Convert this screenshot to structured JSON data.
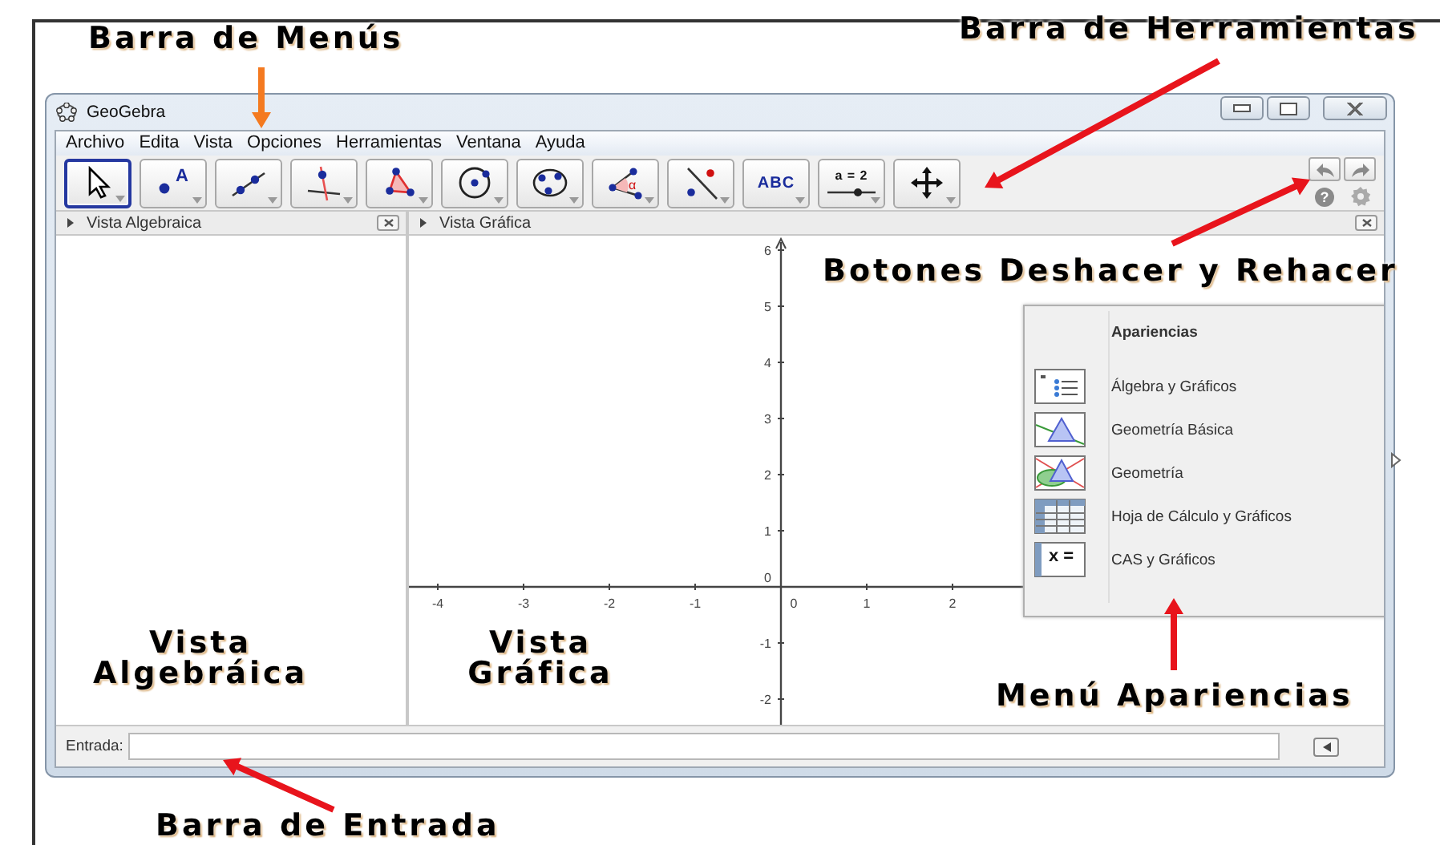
{
  "window": {
    "title": "GeoGebra"
  },
  "menu_bar": [
    "Archivo",
    "Edita",
    "Vista",
    "Opciones",
    "Herramientas",
    "Ventana",
    "Ayuda"
  ],
  "toolbar": {
    "tools": [
      {
        "kind": "move",
        "selected": true
      },
      {
        "kind": "point",
        "label": "A",
        "selected": false
      },
      {
        "kind": "line",
        "selected": false
      },
      {
        "kind": "perpendicular",
        "selected": false
      },
      {
        "kind": "polygon",
        "selected": false
      },
      {
        "kind": "circle",
        "selected": false
      },
      {
        "kind": "conic",
        "selected": false
      },
      {
        "kind": "angle",
        "label": "α",
        "selected": false
      },
      {
        "kind": "reflect",
        "selected": false
      },
      {
        "kind": "text",
        "label": "ABC",
        "selected": false
      },
      {
        "kind": "slider",
        "label": "a = 2",
        "selected": false
      },
      {
        "kind": "move-view",
        "selected": false
      }
    ],
    "help_label": "?"
  },
  "views": [
    {
      "kind": "algebra",
      "title": "Vista Algebraica"
    },
    {
      "kind": "graphics",
      "title": "Vista Gráfica",
      "x_axis_labels": [
        "-4",
        "-3",
        "-2",
        "-1",
        "0",
        "1",
        "2"
      ],
      "y_axis_labels": [
        "6",
        "5",
        "4",
        "3",
        "2",
        "1",
        "0",
        "-1",
        "-2"
      ]
    }
  ],
  "perspectives_menu": {
    "title": "Apariencias",
    "items": [
      {
        "kind": "algebra",
        "label": "Álgebra y Gráficos"
      },
      {
        "kind": "basic-geometry",
        "label": "Geometría Básica"
      },
      {
        "kind": "geometry",
        "label": "Geometría"
      },
      {
        "kind": "spreadsheet",
        "label": "Hoja de Cálculo y Gráficos"
      },
      {
        "kind": "cas",
        "label": "CAS y Gráficos",
        "icon_label": "x ="
      }
    ]
  },
  "input_bar": {
    "label": "Entrada:"
  },
  "annotations": [
    {
      "text": "Barra de Menús",
      "color": "#f47a20"
    },
    {
      "text": "Barra de Herramientas",
      "color": "#e8141c"
    },
    {
      "text": "Botones Deshacer y Rehacer",
      "color": "#e8141c"
    },
    {
      "text": "Vista Algebráica"
    },
    {
      "text": "Vista Gráfica"
    },
    {
      "text": "Menú Apariencias",
      "color": "#e8141c"
    },
    {
      "text": "Barra de Entrada",
      "color": "#e8141c"
    }
  ]
}
